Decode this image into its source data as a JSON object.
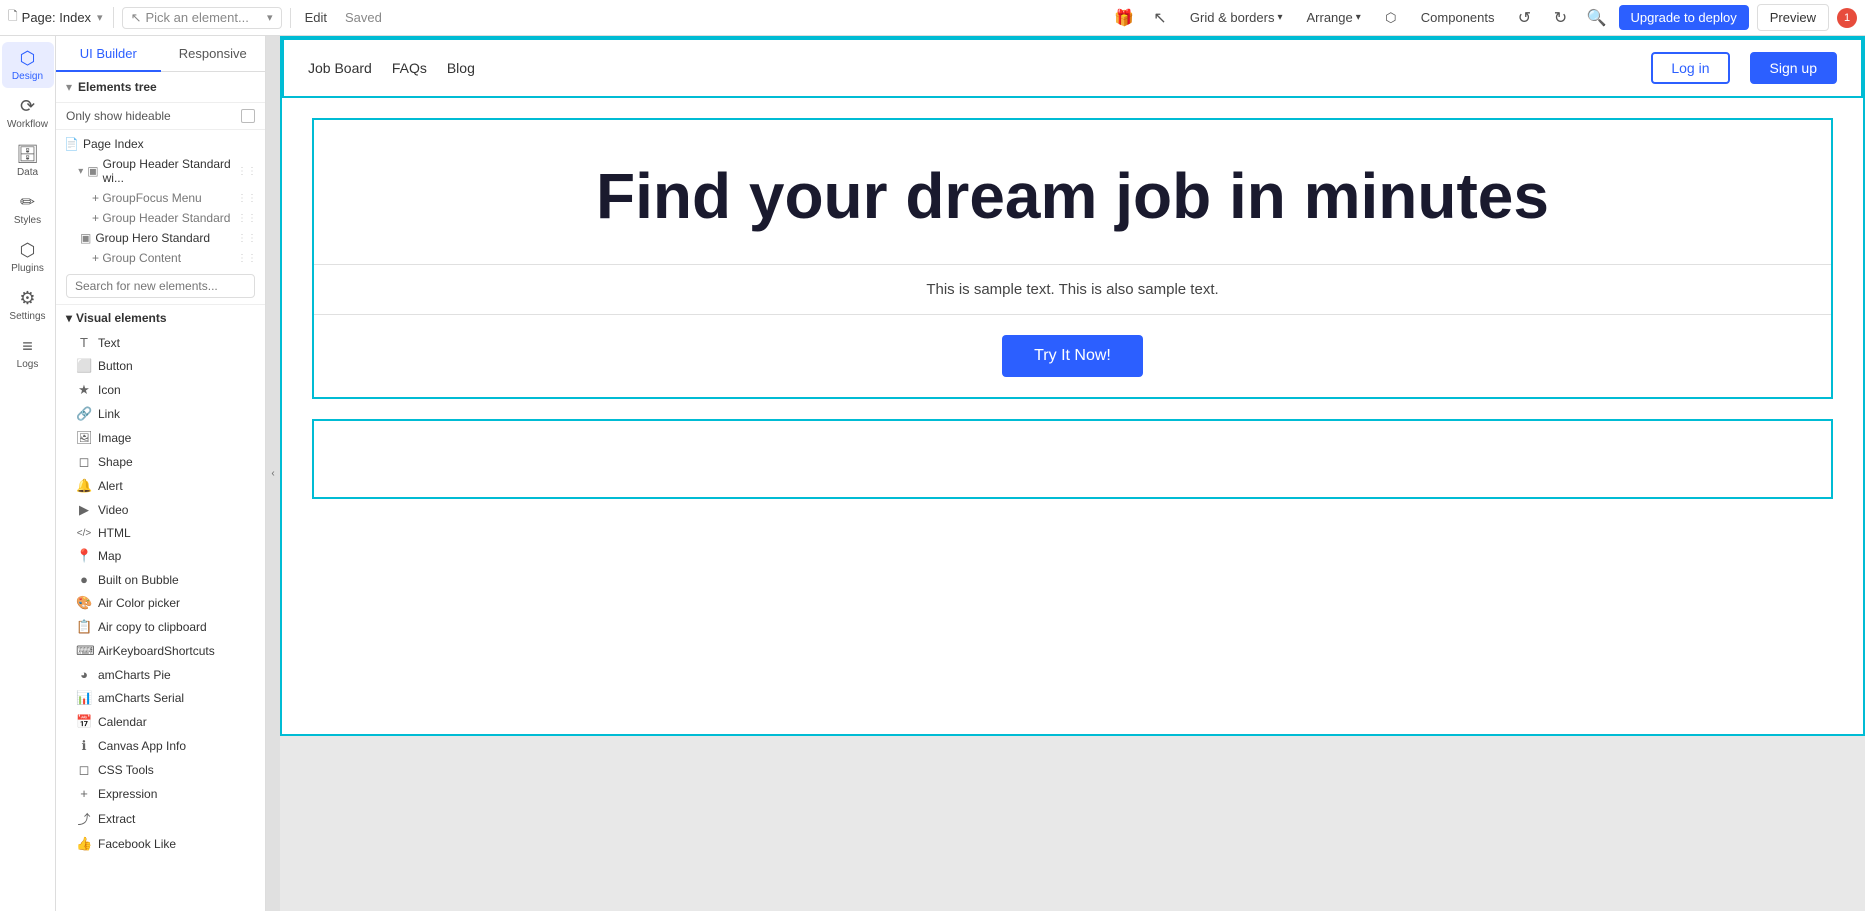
{
  "topbar": {
    "page_label": "Page: Index",
    "pick_element_placeholder": "Pick an element...",
    "edit_label": "Edit",
    "saved_label": "Saved",
    "grid_borders_label": "Grid & borders",
    "arrange_label": "Arrange",
    "components_label": "Components",
    "upgrade_label": "Upgrade to deploy",
    "preview_label": "Preview"
  },
  "icon_sidebar": {
    "items": [
      {
        "id": "design",
        "label": "Design",
        "icon": "⬡"
      },
      {
        "id": "workflow",
        "label": "Workflow",
        "icon": "⟳"
      },
      {
        "id": "data",
        "label": "Data",
        "icon": "🗄"
      },
      {
        "id": "styles",
        "label": "Styles",
        "icon": "✏"
      },
      {
        "id": "plugins",
        "label": "Plugins",
        "icon": "🔌"
      },
      {
        "id": "settings",
        "label": "Settings",
        "icon": "⚙"
      },
      {
        "id": "logs",
        "label": "Logs",
        "icon": "📋"
      }
    ]
  },
  "left_panel": {
    "tabs": [
      {
        "id": "ui-builder",
        "label": "UI Builder"
      },
      {
        "id": "responsive",
        "label": "Responsive"
      }
    ],
    "elements_tree_label": "Elements tree",
    "only_hideable_label": "Only show hideable",
    "search_placeholder": "Search for new elements...",
    "tree_items": [
      {
        "id": "page-index",
        "label": "Page Index",
        "indent": 0,
        "icon": "📄",
        "has_chevron": false
      },
      {
        "id": "group-header-standard-wi",
        "label": "Group Header Standard wi...",
        "indent": 1,
        "icon": "▣",
        "has_chevron": true
      },
      {
        "id": "group-focus-menu",
        "label": "+ GroupFocus Menu",
        "indent": 2,
        "icon": "",
        "has_chevron": false
      },
      {
        "id": "group-header-standard",
        "label": "+ Group Header Standard",
        "indent": 2,
        "icon": "",
        "has_chevron": false
      },
      {
        "id": "group-hero-standard",
        "label": "Group Hero Standard",
        "indent": 1,
        "icon": "▣",
        "has_chevron": false
      },
      {
        "id": "group-content",
        "label": "+ Group Content",
        "indent": 2,
        "icon": "",
        "has_chevron": false
      }
    ],
    "visual_elements_label": "Visual elements",
    "visual_elements": [
      {
        "id": "text",
        "label": "Text",
        "icon": "T"
      },
      {
        "id": "button",
        "label": "Button",
        "icon": "⬜"
      },
      {
        "id": "icon",
        "label": "Icon",
        "icon": "★"
      },
      {
        "id": "link",
        "label": "Link",
        "icon": "🔗"
      },
      {
        "id": "image",
        "label": "Image",
        "icon": "🖼"
      },
      {
        "id": "shape",
        "label": "Shape",
        "icon": "◻"
      },
      {
        "id": "alert",
        "label": "Alert",
        "icon": "🔔"
      },
      {
        "id": "video",
        "label": "Video",
        "icon": "▶"
      },
      {
        "id": "html",
        "label": "HTML",
        "icon": "</>"
      },
      {
        "id": "map",
        "label": "Map",
        "icon": "📍"
      },
      {
        "id": "built-on-bubble",
        "label": "Built on Bubble",
        "icon": "●"
      },
      {
        "id": "air-color-picker",
        "label": "Air Color picker",
        "icon": "🎨"
      },
      {
        "id": "air-copy-clipboard",
        "label": "Air copy to clipboard",
        "icon": "📋"
      },
      {
        "id": "air-keyboard-shortcuts",
        "label": "AirKeyboardShortcuts",
        "icon": "⌨"
      },
      {
        "id": "amcharts-pie",
        "label": "amCharts Pie",
        "icon": "◕"
      },
      {
        "id": "amcharts-serial",
        "label": "amCharts Serial",
        "icon": "📊"
      },
      {
        "id": "calendar",
        "label": "Calendar",
        "icon": "📅"
      },
      {
        "id": "canvas-app-info",
        "label": "Canvas App Info",
        "icon": "ℹ"
      },
      {
        "id": "css-tools",
        "label": "CSS Tools",
        "icon": "◻"
      },
      {
        "id": "expression",
        "label": "Expression",
        "icon": "+"
      },
      {
        "id": "extract",
        "label": "Extract",
        "icon": "⤴"
      },
      {
        "id": "facebook-like",
        "label": "Facebook Like",
        "icon": "👍"
      }
    ]
  },
  "app": {
    "nav": {
      "links": [
        {
          "id": "job-board",
          "label": "Job Board",
          "active": true
        },
        {
          "id": "faqs",
          "label": "FAQs",
          "active": false
        },
        {
          "id": "blog",
          "label": "Blog",
          "active": false
        }
      ],
      "login_label": "Log in",
      "signup_label": "Sign up"
    },
    "hero": {
      "title": "Find your dream job in minutes",
      "subtitle": "This is sample text. This is also sample text.",
      "cta_label": "Try It Now!"
    }
  },
  "colors": {
    "accent": "#2c5fff",
    "border_highlight": "#00bcd4",
    "nav_active": "#2c5fff"
  }
}
